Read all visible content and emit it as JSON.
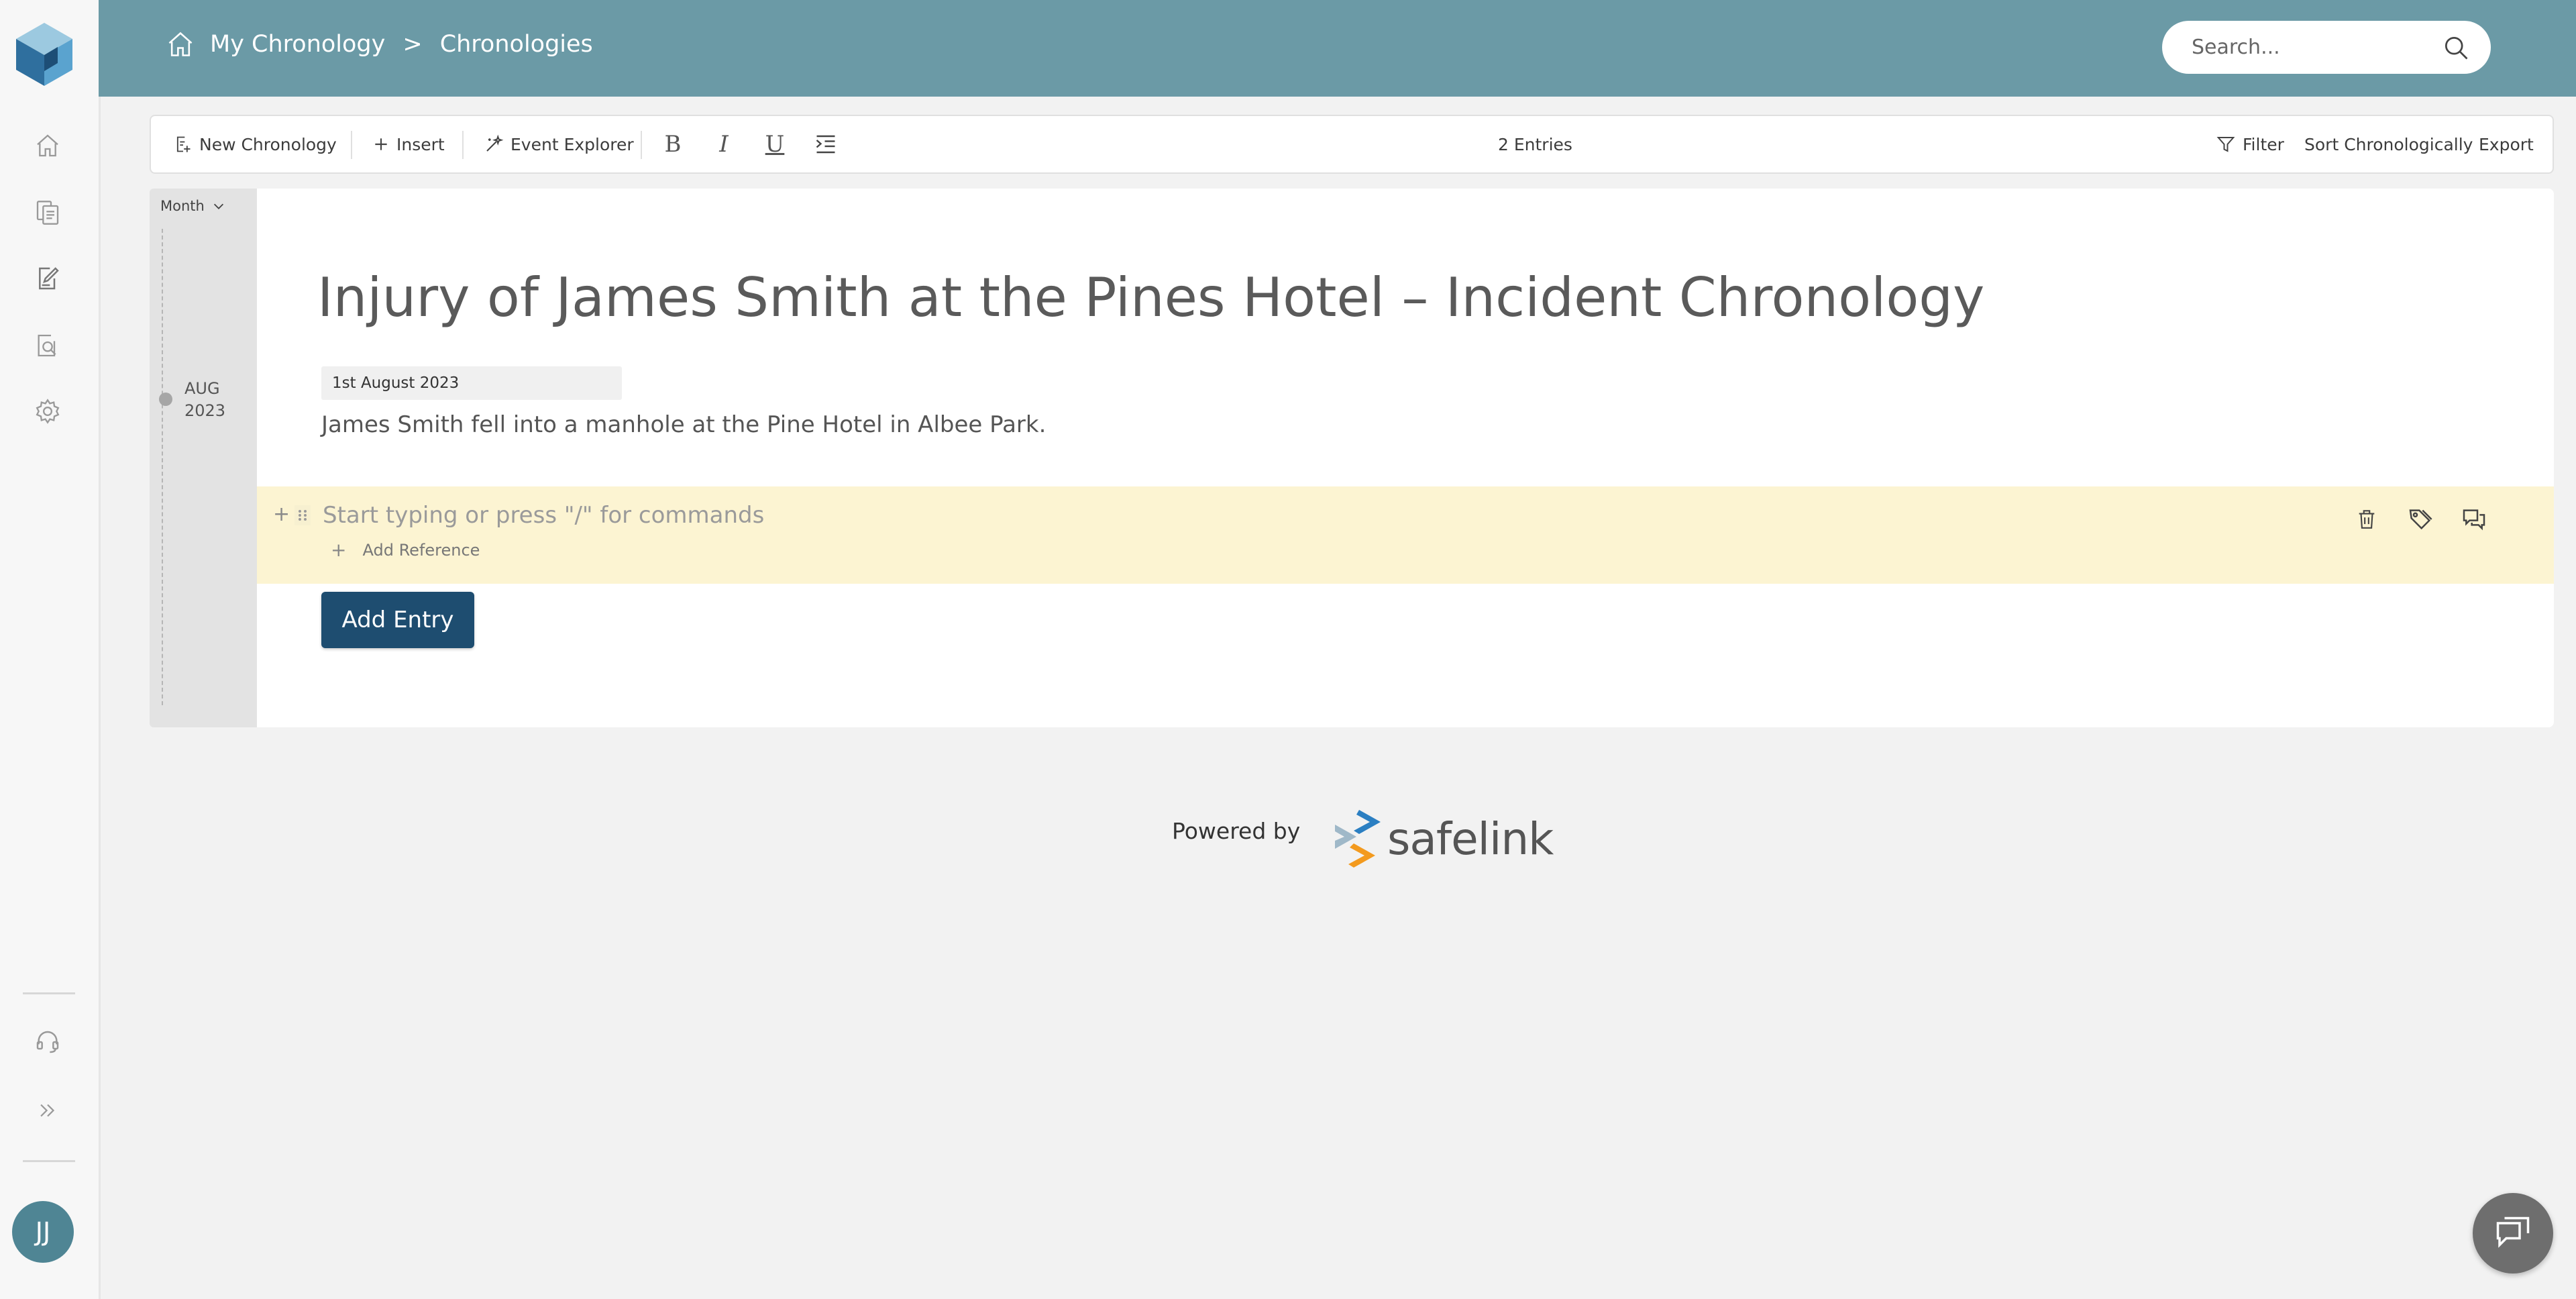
{
  "rail": {
    "nav_icons": [
      "home-icon",
      "documents-icon",
      "chronology-icon",
      "search-report-icon",
      "settings-icon",
      "support-headset-icon",
      "expand-icon"
    ],
    "avatar_initials": "JJ"
  },
  "header": {
    "breadcrumb": {
      "root": "My Chronology",
      "separator": ">",
      "current": "Chronologies"
    },
    "search_placeholder": "Search..."
  },
  "toolbar": {
    "new_chronology": "New Chronology",
    "insert": "Insert",
    "event_explorer": "Event Explorer",
    "format_bold": "B",
    "format_italic": "I",
    "format_underline": "U",
    "entries_count": "2 Entries",
    "filter": "Filter",
    "sort": "Sort Chronologically",
    "export": "Export"
  },
  "timeline": {
    "granularity": "Month",
    "markers": [
      {
        "month": "AUG",
        "year": "2023"
      }
    ]
  },
  "document": {
    "title": "Injury of James Smith at the Pines Hotel – Incident Chronology",
    "entries": [
      {
        "date": "1st August 2023",
        "text": "James Smith fell into a manhole at the Pine Hotel in Albee Park."
      }
    ],
    "new_entry": {
      "placeholder": "Start typing or press \"/\" for commands",
      "add_reference": "Add Reference",
      "actions": [
        "trash-icon",
        "tags-icon",
        "comments-icon"
      ]
    },
    "add_entry_label": "Add Entry"
  },
  "footer": {
    "powered_by": "Powered by",
    "brand": "safelink"
  },
  "colors": {
    "header": "#6b9aa6",
    "primary_button": "#1e4d70",
    "new_entry_highlight": "#fcf4d2",
    "avatar": "#4f8594",
    "brand_blue": "#2b7fc2",
    "brand_orange": "#f39a1e"
  }
}
